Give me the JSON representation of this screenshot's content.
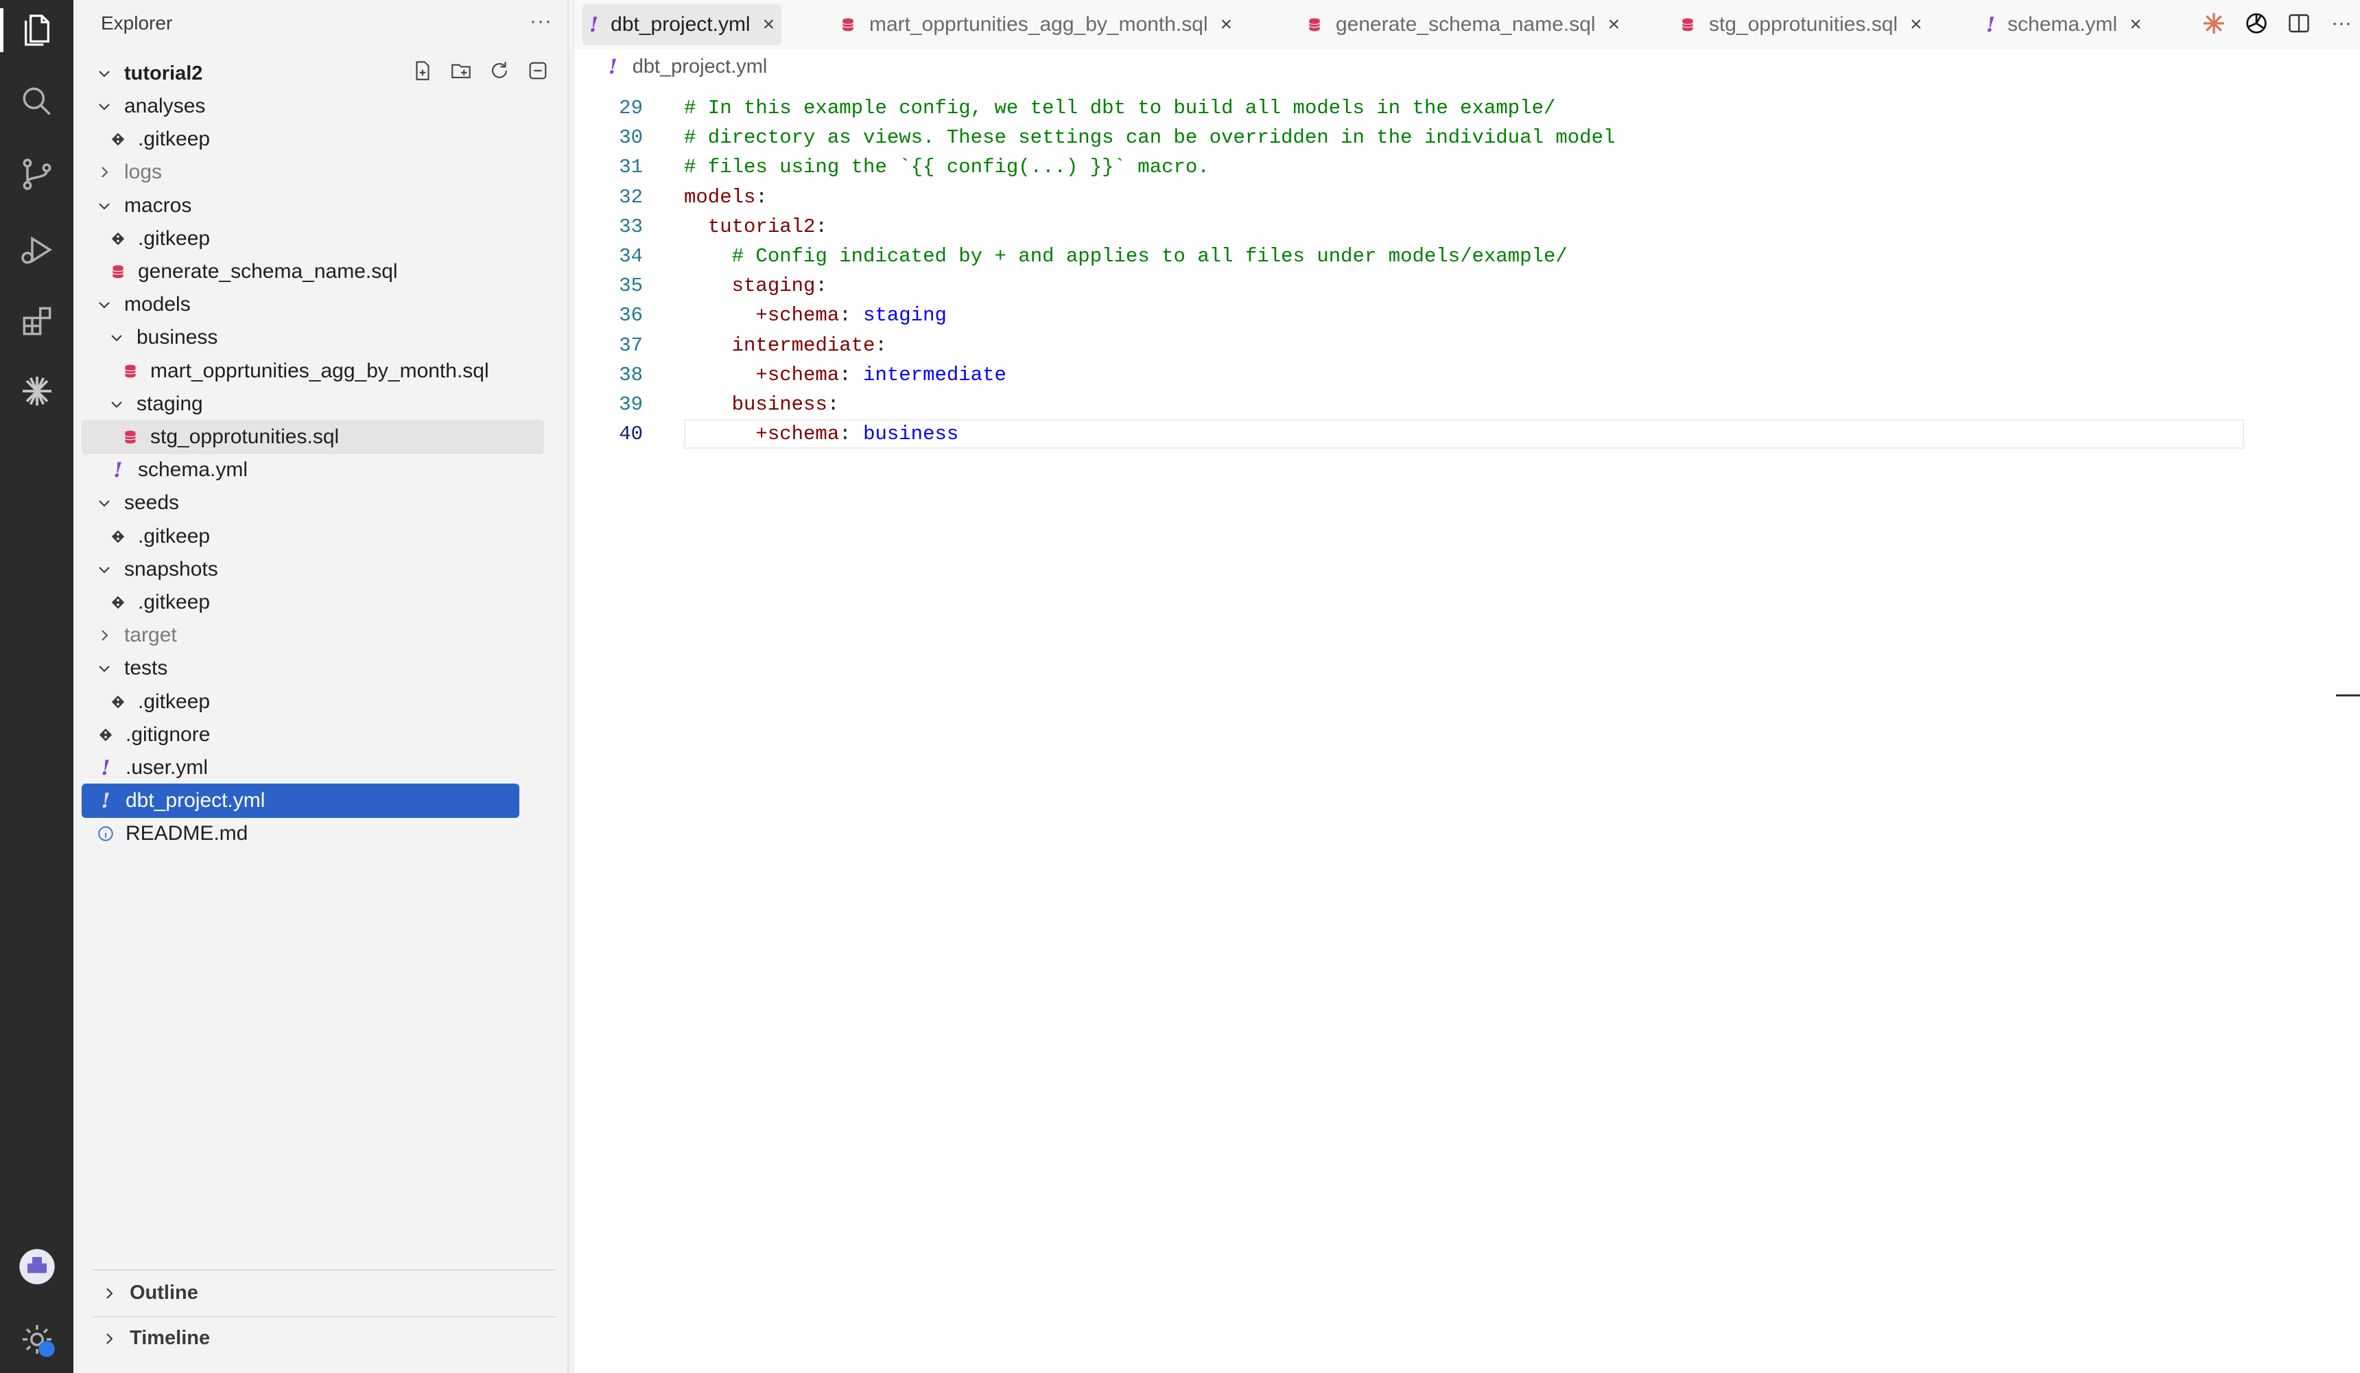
{
  "activity_bar": {
    "items": [
      "explorer-icon",
      "search-icon",
      "source-control-icon",
      "run-debug-icon",
      "extensions-icon",
      "claude-icon"
    ],
    "bottom": [
      "account-icon",
      "settings-icon"
    ]
  },
  "sidebar": {
    "title": "Explorer",
    "more": "···",
    "project": "tutorial2",
    "tree": [
      {
        "label": "analyses",
        "type": "folder-open",
        "depth": 1
      },
      {
        "label": ".gitkeep",
        "type": "git",
        "depth": 2
      },
      {
        "label": "logs",
        "type": "folder-closed",
        "depth": 1,
        "dim": true
      },
      {
        "label": "macros",
        "type": "folder-open",
        "depth": 1
      },
      {
        "label": ".gitkeep",
        "type": "git",
        "depth": 2
      },
      {
        "label": "generate_schema_name.sql",
        "type": "sql",
        "depth": 2
      },
      {
        "label": "models",
        "type": "folder-open",
        "depth": 1
      },
      {
        "label": "business",
        "type": "folder-open",
        "depth": 2
      },
      {
        "label": "mart_opprtunities_agg_by_month.sql",
        "type": "sql",
        "depth": 3
      },
      {
        "label": "staging",
        "type": "folder-open",
        "depth": 2
      },
      {
        "label": "stg_opprotunities.sql",
        "type": "sql",
        "depth": 3
      },
      {
        "label": "schema.yml",
        "type": "yml",
        "depth": 2
      },
      {
        "label": "seeds",
        "type": "folder-open",
        "depth": 1
      },
      {
        "label": ".gitkeep",
        "type": "git",
        "depth": 2
      },
      {
        "label": "snapshots",
        "type": "folder-open",
        "depth": 1
      },
      {
        "label": ".gitkeep",
        "type": "git",
        "depth": 2
      },
      {
        "label": "target",
        "type": "folder-closed",
        "depth": 1,
        "dim": true
      },
      {
        "label": "tests",
        "type": "folder-open",
        "depth": 1
      },
      {
        "label": ".gitkeep",
        "type": "git",
        "depth": 2
      },
      {
        "label": ".gitignore",
        "type": "git",
        "depth": 1
      },
      {
        "label": ".user.yml",
        "type": "yml",
        "depth": 1
      },
      {
        "label": "dbt_project.yml",
        "type": "yml",
        "depth": 1,
        "selected": true
      },
      {
        "label": "README.md",
        "type": "info",
        "depth": 1
      }
    ],
    "sections": [
      {
        "label": "Outline"
      },
      {
        "label": "Timeline"
      }
    ]
  },
  "tabs": [
    {
      "label": "dbt_project.yml",
      "type": "yml",
      "active": true
    },
    {
      "label": "mart_opprtunities_agg_by_month.sql",
      "type": "sql"
    },
    {
      "label": "generate_schema_name.sql",
      "type": "sql"
    },
    {
      "label": "stg_opprotunities.sql",
      "type": "sql"
    },
    {
      "label": "schema.yml",
      "type": "yml"
    }
  ],
  "tab_close": "×",
  "yml_mark": "!",
  "breadcrumb": {
    "file": "dbt_project.yml"
  },
  "code": [
    {
      "n": "29",
      "parts": [
        {
          "t": "# In this example config, we tell dbt to build all models in the example/",
          "c": "comment"
        }
      ]
    },
    {
      "n": "30",
      "parts": [
        {
          "t": "# directory as views. These settings can be overridden in the individual model",
          "c": "comment"
        }
      ]
    },
    {
      "n": "31",
      "parts": [
        {
          "t": "# files using the `{{ config(...) }}` macro.",
          "c": "comment"
        }
      ]
    },
    {
      "n": "32",
      "parts": [
        {
          "t": "models",
          "c": "key"
        },
        {
          "t": ":",
          "c": "plain"
        }
      ]
    },
    {
      "n": "33",
      "parts": [
        {
          "t": "  ",
          "c": "plain"
        },
        {
          "t": "tutorial2",
          "c": "key"
        },
        {
          "t": ":",
          "c": "plain"
        }
      ]
    },
    {
      "n": "34",
      "parts": [
        {
          "t": "    ",
          "c": "plain"
        },
        {
          "t": "# Config indicated by + and applies to all files under models/example/",
          "c": "comment"
        }
      ]
    },
    {
      "n": "35",
      "parts": [
        {
          "t": "    ",
          "c": "plain"
        },
        {
          "t": "staging",
          "c": "key"
        },
        {
          "t": ":",
          "c": "plain"
        }
      ]
    },
    {
      "n": "36",
      "parts": [
        {
          "t": "      ",
          "c": "plain"
        },
        {
          "t": "+schema",
          "c": "key"
        },
        {
          "t": ": ",
          "c": "plain"
        },
        {
          "t": "staging",
          "c": "val"
        }
      ]
    },
    {
      "n": "37",
      "parts": [
        {
          "t": "    ",
          "c": "plain"
        },
        {
          "t": "intermediate",
          "c": "key"
        },
        {
          "t": ":",
          "c": "plain"
        }
      ]
    },
    {
      "n": "38",
      "parts": [
        {
          "t": "      ",
          "c": "plain"
        },
        {
          "t": "+schema",
          "c": "key"
        },
        {
          "t": ": ",
          "c": "plain"
        },
        {
          "t": "intermediate",
          "c": "val"
        }
      ]
    },
    {
      "n": "39",
      "parts": [
        {
          "t": "    ",
          "c": "plain"
        },
        {
          "t": "business",
          "c": "key"
        },
        {
          "t": ":",
          "c": "plain"
        }
      ]
    },
    {
      "n": "40",
      "parts": [
        {
          "t": "      ",
          "c": "plain"
        },
        {
          "t": "+schema",
          "c": "key"
        },
        {
          "t": ": ",
          "c": "plain"
        },
        {
          "t": "business",
          "c": "val"
        }
      ],
      "current": true
    }
  ]
}
